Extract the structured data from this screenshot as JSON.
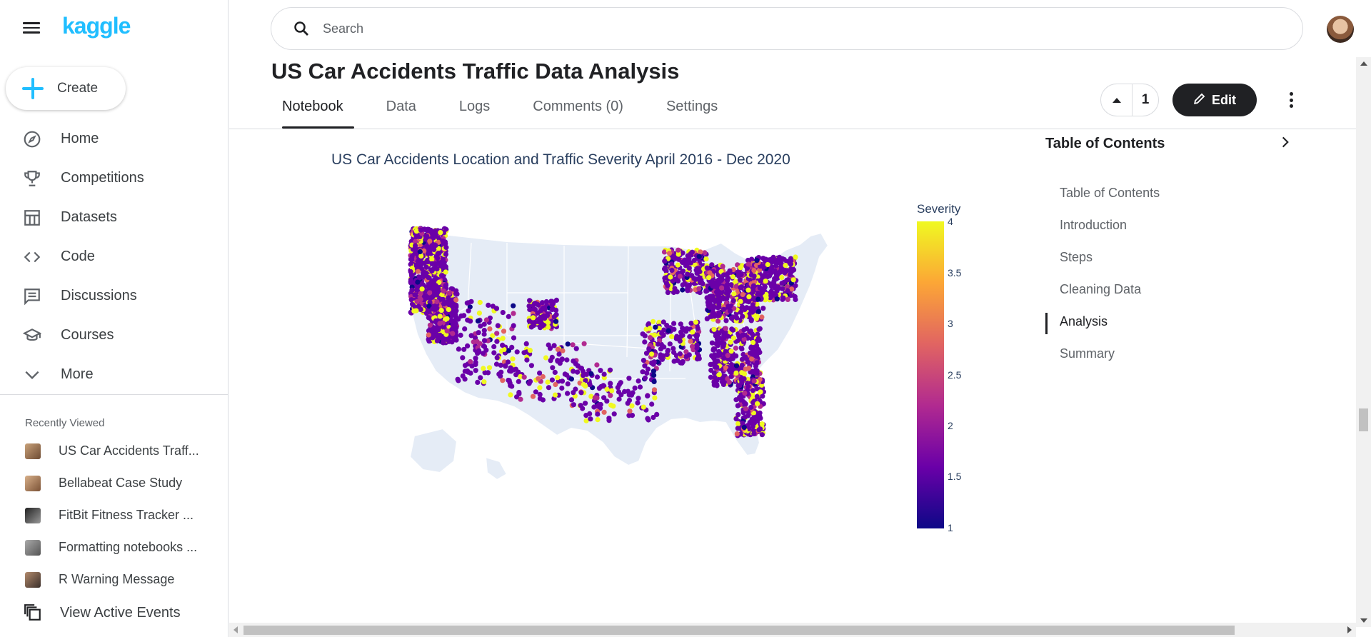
{
  "app": {
    "logo": "kaggle"
  },
  "sidebar": {
    "create_label": "Create",
    "items": [
      {
        "label": "Home",
        "icon": "compass-icon"
      },
      {
        "label": "Competitions",
        "icon": "trophy-icon"
      },
      {
        "label": "Datasets",
        "icon": "table-icon"
      },
      {
        "label": "Code",
        "icon": "code-icon"
      },
      {
        "label": "Discussions",
        "icon": "comment-icon"
      },
      {
        "label": "Courses",
        "icon": "school-icon"
      },
      {
        "label": "More",
        "icon": "chevron-down-icon"
      }
    ],
    "recent_title": "Recently Viewed",
    "recent": [
      {
        "label": "US Car Accidents Traff..."
      },
      {
        "label": "Bellabeat Case Study"
      },
      {
        "label": "FitBit Fitness Tracker ..."
      },
      {
        "label": "Formatting notebooks ..."
      },
      {
        "label": "R Warning Message"
      }
    ],
    "events_label": "View Active Events"
  },
  "search": {
    "placeholder": "Search"
  },
  "notebook": {
    "title": "US Car Accidents Traffic Data Analysis",
    "tabs": [
      "Notebook",
      "Data",
      "Logs",
      "Comments (0)",
      "Settings"
    ],
    "active_tab": "Notebook",
    "vote_count": "1",
    "edit_label": "Edit"
  },
  "chart": {
    "title": "US Car Accidents Location and Traffic Severity April 2016 - Dec 2020",
    "colorbar_title": "Severity",
    "colorbar_ticks": [
      "4",
      "3.5",
      "3",
      "2.5",
      "2",
      "1.5",
      "1"
    ]
  },
  "chart_data": {
    "type": "scatter",
    "title": "US Car Accidents Location and Traffic Severity April 2016 - Dec 2020",
    "colorscale": "plasma",
    "color_variable": "Severity",
    "color_range": [
      1,
      4
    ],
    "colorbar_ticks": [
      1,
      1.5,
      2,
      2.5,
      3,
      3.5,
      4
    ],
    "map_scope": "usa"
  },
  "toc": {
    "title": "Table of Contents",
    "items": [
      "Table of Contents",
      "Introduction",
      "Steps",
      "Cleaning Data",
      "Analysis",
      "Summary"
    ],
    "active": "Analysis"
  }
}
